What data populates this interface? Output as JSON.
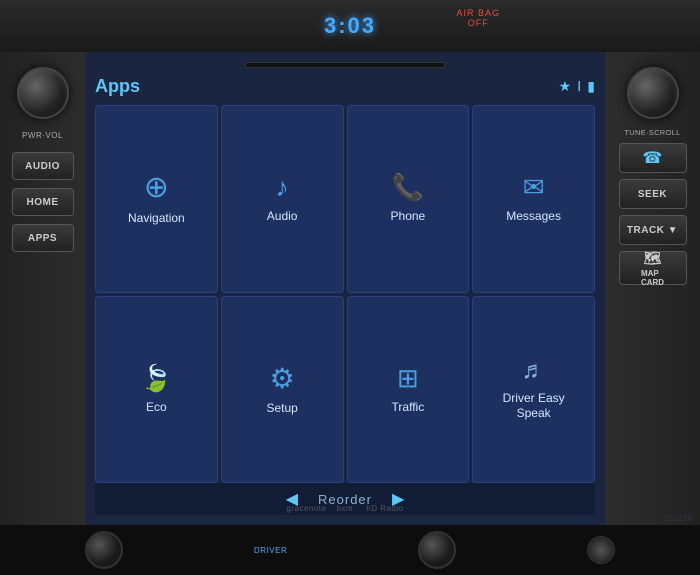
{
  "header": {
    "clock": "3:03",
    "airbag": "AIR BAG\nOFF"
  },
  "left_controls": {
    "knob_label": "PWR·VOL",
    "buttons": [
      "AUDIO",
      "HOME",
      "APPS"
    ]
  },
  "right_controls": {
    "knob_label": "TUNE·SCROLL",
    "buttons": [
      "SEEK",
      "TRACK"
    ],
    "special": [
      "MAP\nCARD"
    ]
  },
  "screen": {
    "title": "Apps",
    "apps": [
      {
        "id": "navigation",
        "label": "Navigation",
        "icon": "🧭",
        "icon_type": "nav"
      },
      {
        "id": "audio",
        "label": "Audio",
        "icon": "♪",
        "icon_type": "audio"
      },
      {
        "id": "phone",
        "label": "Phone",
        "icon": "📞",
        "icon_type": "phone"
      },
      {
        "id": "messages",
        "label": "Messages",
        "icon": "✉",
        "icon_type": "messages"
      },
      {
        "id": "eco",
        "label": "Eco",
        "icon": "🍃",
        "icon_type": "leaf"
      },
      {
        "id": "setup",
        "label": "Setup",
        "icon": "⚙",
        "icon_type": "gear"
      },
      {
        "id": "traffic",
        "label": "Traffic",
        "icon": "⊞",
        "icon_type": "traffic"
      },
      {
        "id": "driver-easy-speak",
        "label": "Driver Easy\nSpeak",
        "icon": "🎵",
        "icon_type": "driver"
      }
    ],
    "reorder": "Reorder",
    "logos": [
      "gracenote",
      "bxm·",
      "hD Radio"
    ]
  },
  "serial": "S10179"
}
